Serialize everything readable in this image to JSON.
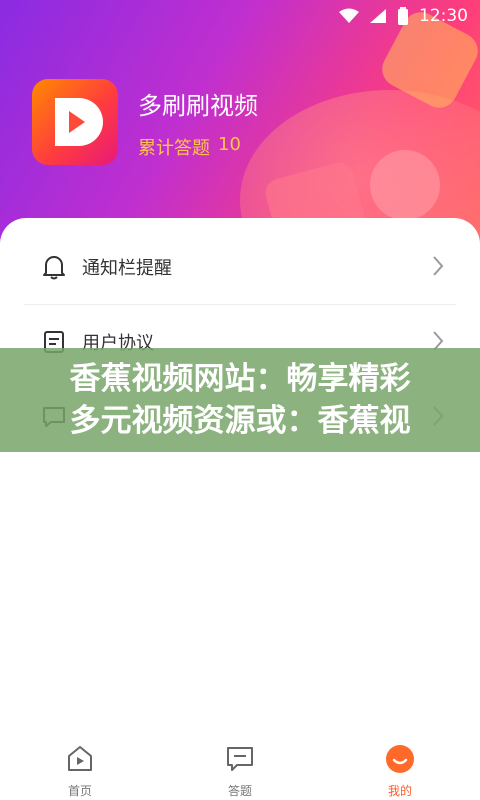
{
  "status_bar": {
    "time": "12:30",
    "icons": [
      "wifi-icon",
      "signal-icon",
      "battery-icon"
    ]
  },
  "profile": {
    "app_name": "多刷刷视频",
    "answer_label": "累计答题",
    "answer_count": "10",
    "logo_icon": "play-logo-icon"
  },
  "menu": {
    "items": [
      {
        "label": "通知栏提醒",
        "icon": "bell-icon"
      },
      {
        "label": "用户协议",
        "icon": "document-icon"
      },
      {
        "label": "",
        "icon": "feedback-icon"
      }
    ]
  },
  "overlay_banner": {
    "line1": "香蕉视频网站：畅享精彩",
    "line2": "多元视频资源或：香蕉视"
  },
  "tab_bar": {
    "tabs": [
      {
        "label": "首页",
        "icon": "home-play-icon",
        "active": false
      },
      {
        "label": "答题",
        "icon": "chat-bubble-icon",
        "active": false
      },
      {
        "label": "我的",
        "icon": "smile-face-icon",
        "active": true
      }
    ]
  },
  "colors": {
    "gradient_start": "#8a2be2",
    "gradient_end": "#ff6b5a",
    "accent_orange": "#ff5a2a",
    "count_yellow": "#ffc24a",
    "banner_green": "#78a569"
  }
}
